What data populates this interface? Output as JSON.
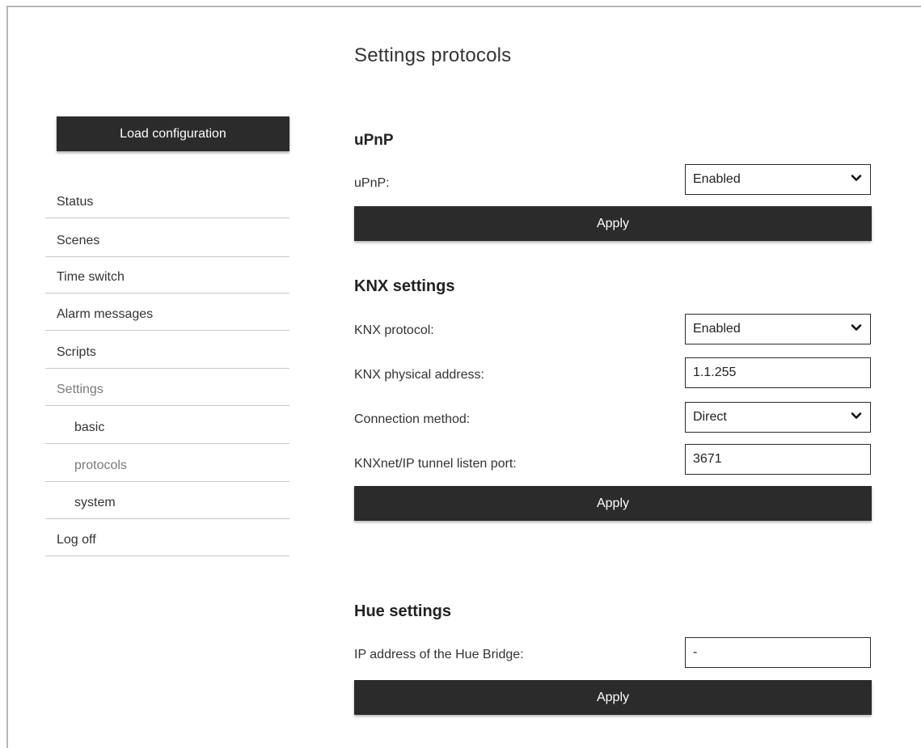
{
  "page": {
    "title": "Settings protocols"
  },
  "sidebar": {
    "load_button": "Load configuration",
    "items": [
      {
        "label": "Status"
      },
      {
        "label": "Scenes"
      },
      {
        "label": "Time switch"
      },
      {
        "label": "Alarm messages"
      },
      {
        "label": "Scripts"
      },
      {
        "label": "Settings"
      },
      {
        "label": "basic"
      },
      {
        "label": "protocols"
      },
      {
        "label": "system"
      },
      {
        "label": "Log off"
      }
    ]
  },
  "upnp": {
    "title": "uPnP",
    "field_label": "uPnP:",
    "value": "Enabled",
    "apply": "Apply"
  },
  "knx": {
    "title": "KNX settings",
    "protocol_label": "KNX protocol:",
    "protocol_value": "Enabled",
    "address_label": "KNX physical address:",
    "address_value": "1.1.255",
    "method_label": "Connection method:",
    "method_value": "Direct",
    "port_label": "KNXnet/IP tunnel listen port:",
    "port_value": "3671",
    "apply": "Apply"
  },
  "hue": {
    "title": "Hue settings",
    "ip_label": "IP address of the Hue Bridge:",
    "ip_value": "-",
    "apply": "Apply"
  },
  "icons": {
    "dropdown": "chevron-down-icon"
  }
}
